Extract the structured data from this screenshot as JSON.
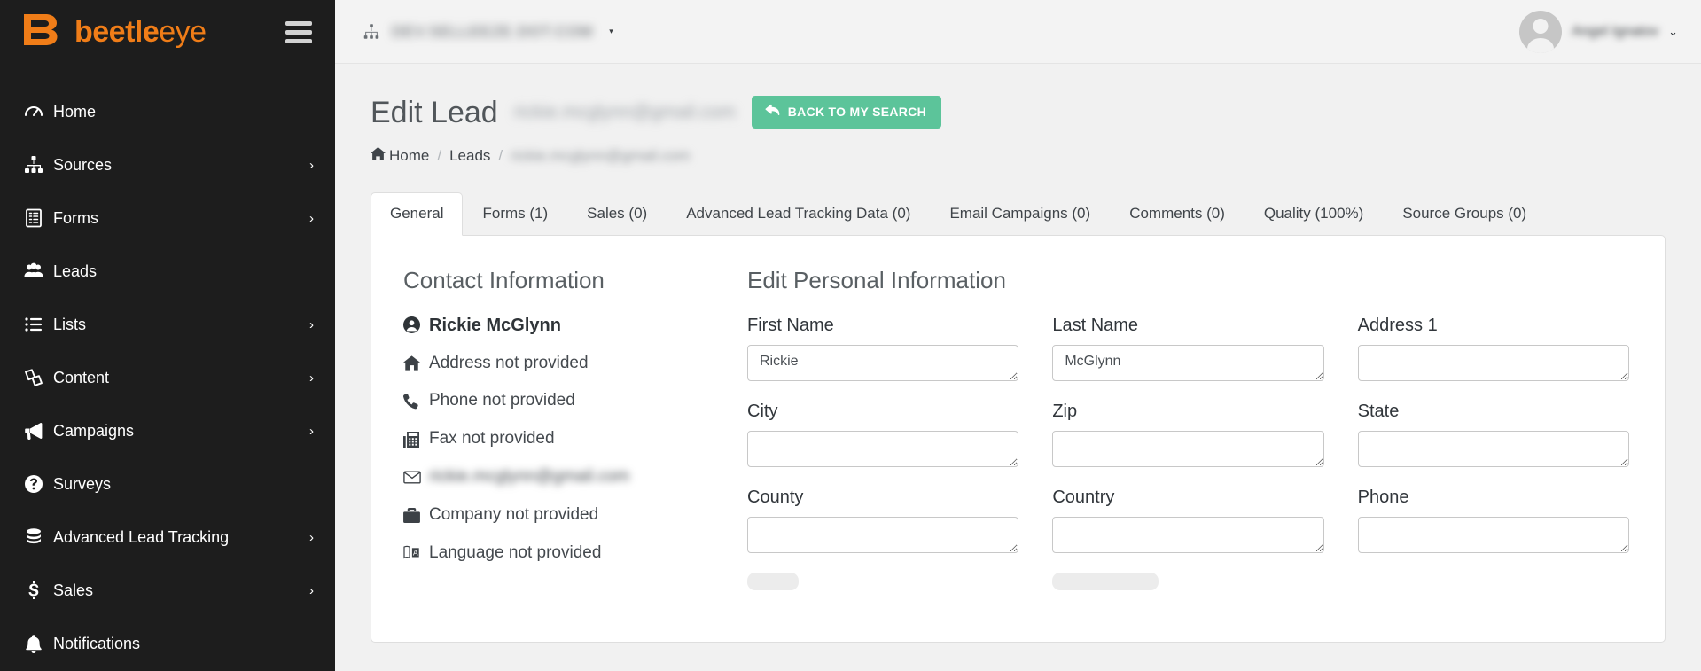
{
  "brand": {
    "name_bold": "beetle",
    "name_light": "eye",
    "logo_icon": "beetleeye-logo-icon"
  },
  "sidebar": {
    "toggle_icon": "hamburger-icon",
    "items": [
      {
        "label": "Home",
        "icon": "speedometer-icon",
        "caret": false
      },
      {
        "label": "Sources",
        "icon": "sitemap-icon",
        "caret": true
      },
      {
        "label": "Forms",
        "icon": "form-document-icon",
        "caret": true
      },
      {
        "label": "Leads",
        "icon": "users-group-icon",
        "caret": false
      },
      {
        "label": "Lists",
        "icon": "list-icon",
        "caret": true
      },
      {
        "label": "Content",
        "icon": "content-pages-icon",
        "caret": true
      },
      {
        "label": "Campaigns",
        "icon": "megaphone-icon",
        "caret": true
      },
      {
        "label": "Surveys",
        "icon": "question-circle-icon",
        "caret": false
      },
      {
        "label": "Advanced Lead Tracking",
        "icon": "database-icon",
        "caret": true
      },
      {
        "label": "Sales",
        "icon": "dollar-sign-icon",
        "caret": true
      },
      {
        "label": "Notifications",
        "icon": "bell-icon",
        "caret": false
      }
    ],
    "caret_glyph": "›"
  },
  "topbar": {
    "org_icon": "sitemap-icon",
    "org_name": "DEV.SELLEEZE.DOT.COM",
    "org_caret": "▾",
    "user_name": "Angel Ignatov",
    "user_caret": "⌄",
    "avatar_icon": "user-avatar-icon"
  },
  "page": {
    "title": "Edit Lead",
    "title_sub": "rickie.mcglynn@gmail.com",
    "back_button": {
      "label": "BACK TO MY SEARCH",
      "icon": "undo-arrow-icon",
      "color": "#5cc49a"
    }
  },
  "breadcrumb": {
    "home_icon": "home-icon",
    "items": [
      "Home",
      "Leads",
      "rickie.mcglynn@gmail.com"
    ],
    "separator": "/"
  },
  "tabs": [
    {
      "label": "General",
      "active": true
    },
    {
      "label": "Forms (1)",
      "active": false
    },
    {
      "label": "Sales (0)",
      "active": false
    },
    {
      "label": "Advanced Lead Tracking Data (0)",
      "active": false
    },
    {
      "label": "Email Campaigns (0)",
      "active": false
    },
    {
      "label": "Comments (0)",
      "active": false
    },
    {
      "label": "Quality (100%)",
      "active": false
    },
    {
      "label": "Source Groups (0)",
      "active": false
    }
  ],
  "contact": {
    "heading": "Contact Information",
    "lines": [
      {
        "icon": "user-circle-icon",
        "text": "Rickie McGlynn",
        "blurred": false,
        "bold": true
      },
      {
        "icon": "home-icon",
        "text": "Address not provided",
        "blurred": false,
        "bold": false
      },
      {
        "icon": "phone-icon",
        "text": "Phone not provided",
        "blurred": false,
        "bold": false
      },
      {
        "icon": "fax-icon",
        "text": "Fax not provided",
        "blurred": false,
        "bold": false
      },
      {
        "icon": "envelope-icon",
        "text": "rickie.mcglynn@gmail.com",
        "blurred": true,
        "bold": false
      },
      {
        "icon": "briefcase-icon",
        "text": "Company not provided",
        "blurred": false,
        "bold": false
      },
      {
        "icon": "language-icon",
        "text": "Language not provided",
        "blurred": false,
        "bold": false
      }
    ]
  },
  "form": {
    "heading": "Edit Personal Information",
    "fields": [
      {
        "label": "First Name",
        "value": "Rickie"
      },
      {
        "label": "Last Name",
        "value": "McGlynn"
      },
      {
        "label": "Address 1",
        "value": ""
      },
      {
        "label": "City",
        "value": ""
      },
      {
        "label": "Zip",
        "value": ""
      },
      {
        "label": "State",
        "value": ""
      },
      {
        "label": "County",
        "value": ""
      },
      {
        "label": "Country",
        "value": ""
      },
      {
        "label": "Phone",
        "value": ""
      }
    ]
  }
}
